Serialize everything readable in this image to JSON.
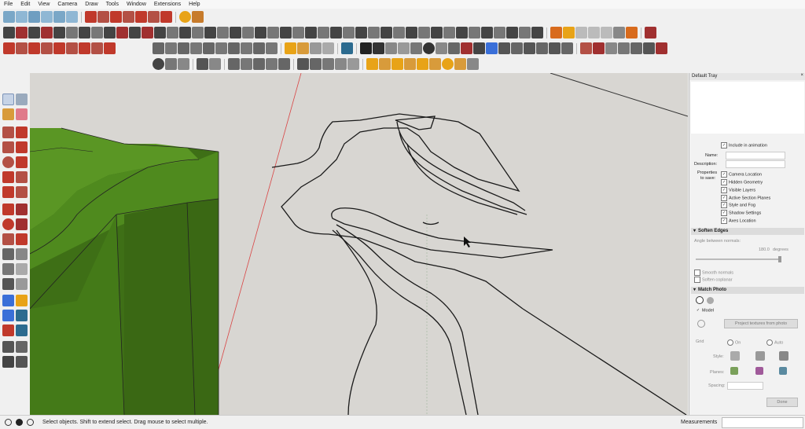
{
  "menu": [
    "File",
    "Edit",
    "View",
    "Camera",
    "Draw",
    "Tools",
    "Window",
    "Extensions",
    "Help"
  ],
  "tray": {
    "title": "Default Tray",
    "close": "×",
    "scenes": {
      "include_animation": "Include in animation",
      "name_label": "Name:",
      "description_label": "Description:",
      "properties_label_1": "Properties",
      "properties_label_2": "to save:",
      "properties": [
        "Camera Location",
        "Hidden Geometry",
        "Visible Layers",
        "Active Section Planes",
        "Style and Fog",
        "Shadow Settings",
        "Axes Location"
      ]
    },
    "soften": {
      "title": "Soften Edges",
      "angle_label": "Angle between normals:",
      "angle_value": "180.0",
      "angle_unit": "degrees",
      "smooth_normals": "Smooth normals",
      "soften_coplanar": "Soften coplanar"
    },
    "match_photo": {
      "title": "Match Photo",
      "model_label": "Model",
      "project_button": "Project textures from photo",
      "grid_label": "Grid",
      "grid_on": "On",
      "grid_auto": "Auto",
      "style_label": "Style:",
      "planes_label": "Planes:",
      "spacing_label": "Spacing:",
      "done_button": "Done"
    }
  },
  "status": {
    "message": "Select objects. Shift to extend select. Drag mouse to select multiple.",
    "measurements_label": "Measurements"
  },
  "colors": {
    "viewport_bg": "#d8d6d2",
    "terrain": "#4f8a1e",
    "terrain_dark": "#3e6f16"
  }
}
